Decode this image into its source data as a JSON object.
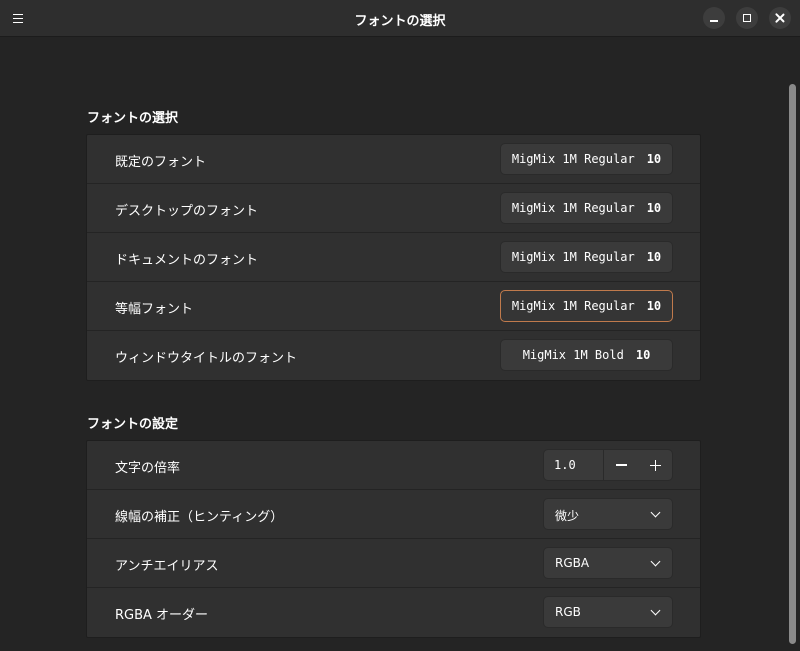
{
  "window": {
    "title": "フォントの選択"
  },
  "sections": {
    "fonts": {
      "title": "フォントの選択",
      "rows": [
        {
          "label": "既定のフォント",
          "font": "MigMix 1M Regular",
          "size": "10"
        },
        {
          "label": "デスクトップのフォント",
          "font": "MigMix 1M Regular",
          "size": "10"
        },
        {
          "label": "ドキュメントのフォント",
          "font": "MigMix 1M Regular",
          "size": "10"
        },
        {
          "label": "等幅フォント",
          "font": "MigMix 1M Regular",
          "size": "10"
        },
        {
          "label": "ウィンドウタイトルのフォント",
          "font": "MigMix 1M Bold",
          "size": "10"
        }
      ]
    },
    "settings": {
      "title": "フォントの設定",
      "scale": {
        "label": "文字の倍率",
        "value": "1.0"
      },
      "hinting": {
        "label": "線幅の補正（ヒンティング）",
        "value": "微少"
      },
      "antialias": {
        "label": "アンチエイリアス",
        "value": "RGBA"
      },
      "rgba_order": {
        "label": "RGBA オーダー",
        "value": "RGB"
      }
    }
  },
  "colors": {
    "accent_focus": "#c07a4c",
    "background": "#242424",
    "card": "#303030"
  }
}
